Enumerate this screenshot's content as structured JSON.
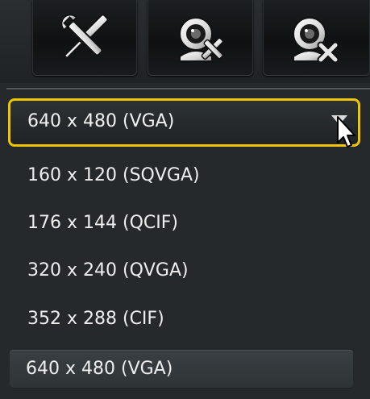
{
  "toolbar": {
    "buttons": [
      {
        "icon": "tools-icon"
      },
      {
        "icon": "camera-settings-icon"
      },
      {
        "icon": "camera-remove-icon"
      }
    ]
  },
  "resolution_dropdown": {
    "selected_value": "640 x 480 (VGA)",
    "options": [
      {
        "label": "160 x 120 (SQVGA)",
        "selected": false
      },
      {
        "label": "176 x 144 (QCIF)",
        "selected": false
      },
      {
        "label": "320 x 240 (QVGA)",
        "selected": false
      },
      {
        "label": "352 x 288 (CIF)",
        "selected": false
      },
      {
        "label": "640 x 480 (VGA)",
        "selected": true
      }
    ]
  },
  "colors": {
    "panel_background": "#25292c",
    "focus_border": "#f2c400",
    "text": "#eeeeee"
  }
}
